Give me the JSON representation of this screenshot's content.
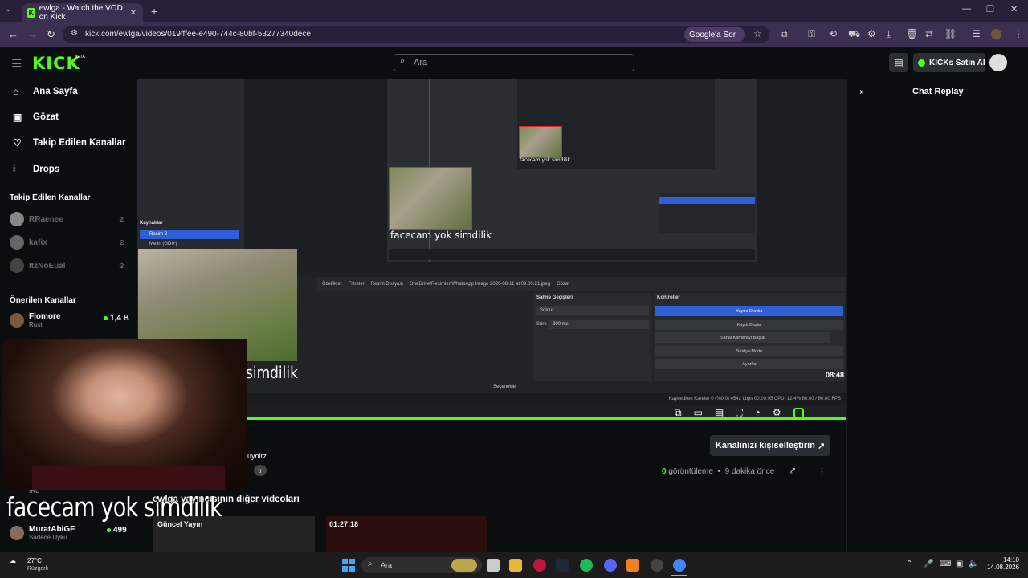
{
  "browser": {
    "tab_title": "ewlga - Watch the VOD on Kick",
    "url": "kick.com/ewlga/videos/019fffee-e490-744c-80bf-53277340dece",
    "google_sor": "Google'a Sor"
  },
  "header": {
    "logo": "KICK",
    "beta": "BETA",
    "search_placeholder": "Ara",
    "kicks_button": "KICKs Satın Al"
  },
  "sidebar": {
    "nav": [
      {
        "label": "Ana Sayfa",
        "icon": "home-icon"
      },
      {
        "label": "Gözat",
        "icon": "browse-icon"
      },
      {
        "label": "Takip Edilen Kanallar",
        "icon": "heart-icon"
      },
      {
        "label": "Drops",
        "icon": "drops-icon"
      }
    ],
    "followed_heading": "Takip Edilen Kanallar",
    "followed": [
      {
        "name": "RRaenee"
      },
      {
        "name": "kafix"
      },
      {
        "name": "ItzNoEual"
      }
    ],
    "recommended_heading": "Önerilen Kanallar",
    "recommended": [
      {
        "name": "Flomore",
        "sub": "Rust",
        "viewers": "1,4 B"
      },
      {
        "name": "MuratAbiGF",
        "sub": "Sadece Uyku",
        "viewers": "499"
      }
    ],
    "irl_label": "IRL"
  },
  "video": {
    "duration": "08:48",
    "overlay_text_small": "facecam yok simdilik",
    "overlay_text_medium": "simdilik",
    "obs_scene_title": "Sahne Geçişleri",
    "obs_controls_title": "Kontroller",
    "obs_sources_title": "Kaynaklar",
    "obs_source_1": "Resim 2",
    "obs_source_2": "Metin (GDI+)",
    "obs_tabs": [
      "Özellikler",
      "Filtreler",
      "Resim Dosyası",
      "OneDrive/Resimler/WhatsApp Image 2026-08-11 at 09.00.21.jpeg",
      "Gözat"
    ],
    "obs_scene_value": "Soldur",
    "obs_duration_label": "Süre",
    "obs_duration_value": "300 ms",
    "obs_buttons": [
      "Yayını Durdur",
      "Kaydı Başlat",
      "Sanal Kamerayı Başlat",
      "Stüdyo Modu",
      "Ayarlar"
    ],
    "obs_status": "Kaybedilen Kareler 0 (%0.0)   4542 kbps   00:00:05   CPU: 12.4%   60.00 / 60.00 FPS",
    "obs_selected": "Seçenekler",
    "facecam_caption": "facecam yok simdilik",
    "progress": 1.0
  },
  "info": {
    "customize_button": "Kanalınızı kişiselleştirin",
    "views_count": "0",
    "views_label": "görüntüleme",
    "time_ago": "9 dakika önce",
    "title_fragment": "uyoirz",
    "tag": "tr",
    "more_videos_heading": "ewlga yayıncısının diğer videoları",
    "thumbnails": [
      {
        "label": "Güncel Yayın"
      },
      {
        "label": "01:27:18"
      }
    ]
  },
  "chat": {
    "title": "Chat Replay"
  },
  "taskbar": {
    "temp": "27°C",
    "weather": "Rüzgarlı",
    "search": "Ara",
    "time": "14:10",
    "date": "14.08.2026"
  },
  "colors": {
    "kick_green": "#53fc18",
    "bg": "#0b0e0f",
    "browser_purple": "#3d2f52"
  }
}
